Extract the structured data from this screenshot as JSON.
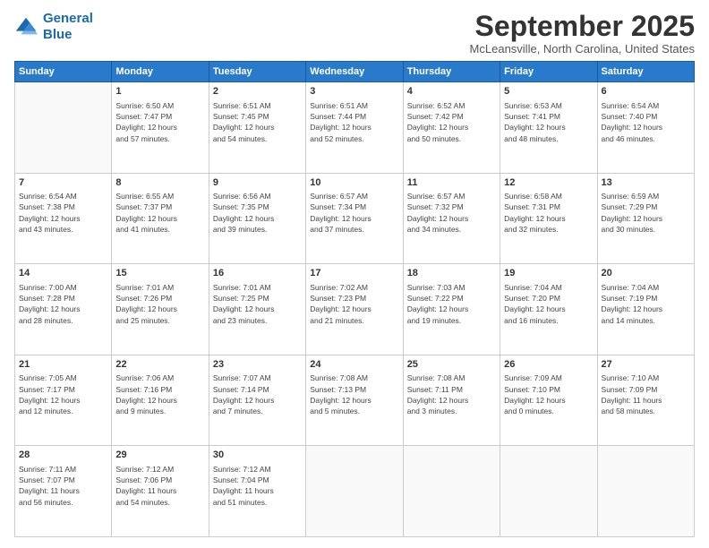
{
  "logo": {
    "line1": "General",
    "line2": "Blue"
  },
  "title": "September 2025",
  "location": "McLeansville, North Carolina, United States",
  "days_header": [
    "Sunday",
    "Monday",
    "Tuesday",
    "Wednesday",
    "Thursday",
    "Friday",
    "Saturday"
  ],
  "weeks": [
    [
      {
        "num": "",
        "info": ""
      },
      {
        "num": "1",
        "info": "Sunrise: 6:50 AM\nSunset: 7:47 PM\nDaylight: 12 hours\nand 57 minutes."
      },
      {
        "num": "2",
        "info": "Sunrise: 6:51 AM\nSunset: 7:45 PM\nDaylight: 12 hours\nand 54 minutes."
      },
      {
        "num": "3",
        "info": "Sunrise: 6:51 AM\nSunset: 7:44 PM\nDaylight: 12 hours\nand 52 minutes."
      },
      {
        "num": "4",
        "info": "Sunrise: 6:52 AM\nSunset: 7:42 PM\nDaylight: 12 hours\nand 50 minutes."
      },
      {
        "num": "5",
        "info": "Sunrise: 6:53 AM\nSunset: 7:41 PM\nDaylight: 12 hours\nand 48 minutes."
      },
      {
        "num": "6",
        "info": "Sunrise: 6:54 AM\nSunset: 7:40 PM\nDaylight: 12 hours\nand 46 minutes."
      }
    ],
    [
      {
        "num": "7",
        "info": "Sunrise: 6:54 AM\nSunset: 7:38 PM\nDaylight: 12 hours\nand 43 minutes."
      },
      {
        "num": "8",
        "info": "Sunrise: 6:55 AM\nSunset: 7:37 PM\nDaylight: 12 hours\nand 41 minutes."
      },
      {
        "num": "9",
        "info": "Sunrise: 6:56 AM\nSunset: 7:35 PM\nDaylight: 12 hours\nand 39 minutes."
      },
      {
        "num": "10",
        "info": "Sunrise: 6:57 AM\nSunset: 7:34 PM\nDaylight: 12 hours\nand 37 minutes."
      },
      {
        "num": "11",
        "info": "Sunrise: 6:57 AM\nSunset: 7:32 PM\nDaylight: 12 hours\nand 34 minutes."
      },
      {
        "num": "12",
        "info": "Sunrise: 6:58 AM\nSunset: 7:31 PM\nDaylight: 12 hours\nand 32 minutes."
      },
      {
        "num": "13",
        "info": "Sunrise: 6:59 AM\nSunset: 7:29 PM\nDaylight: 12 hours\nand 30 minutes."
      }
    ],
    [
      {
        "num": "14",
        "info": "Sunrise: 7:00 AM\nSunset: 7:28 PM\nDaylight: 12 hours\nand 28 minutes."
      },
      {
        "num": "15",
        "info": "Sunrise: 7:01 AM\nSunset: 7:26 PM\nDaylight: 12 hours\nand 25 minutes."
      },
      {
        "num": "16",
        "info": "Sunrise: 7:01 AM\nSunset: 7:25 PM\nDaylight: 12 hours\nand 23 minutes."
      },
      {
        "num": "17",
        "info": "Sunrise: 7:02 AM\nSunset: 7:23 PM\nDaylight: 12 hours\nand 21 minutes."
      },
      {
        "num": "18",
        "info": "Sunrise: 7:03 AM\nSunset: 7:22 PM\nDaylight: 12 hours\nand 19 minutes."
      },
      {
        "num": "19",
        "info": "Sunrise: 7:04 AM\nSunset: 7:20 PM\nDaylight: 12 hours\nand 16 minutes."
      },
      {
        "num": "20",
        "info": "Sunrise: 7:04 AM\nSunset: 7:19 PM\nDaylight: 12 hours\nand 14 minutes."
      }
    ],
    [
      {
        "num": "21",
        "info": "Sunrise: 7:05 AM\nSunset: 7:17 PM\nDaylight: 12 hours\nand 12 minutes."
      },
      {
        "num": "22",
        "info": "Sunrise: 7:06 AM\nSunset: 7:16 PM\nDaylight: 12 hours\nand 9 minutes."
      },
      {
        "num": "23",
        "info": "Sunrise: 7:07 AM\nSunset: 7:14 PM\nDaylight: 12 hours\nand 7 minutes."
      },
      {
        "num": "24",
        "info": "Sunrise: 7:08 AM\nSunset: 7:13 PM\nDaylight: 12 hours\nand 5 minutes."
      },
      {
        "num": "25",
        "info": "Sunrise: 7:08 AM\nSunset: 7:11 PM\nDaylight: 12 hours\nand 3 minutes."
      },
      {
        "num": "26",
        "info": "Sunrise: 7:09 AM\nSunset: 7:10 PM\nDaylight: 12 hours\nand 0 minutes."
      },
      {
        "num": "27",
        "info": "Sunrise: 7:10 AM\nSunset: 7:09 PM\nDaylight: 11 hours\nand 58 minutes."
      }
    ],
    [
      {
        "num": "28",
        "info": "Sunrise: 7:11 AM\nSunset: 7:07 PM\nDaylight: 11 hours\nand 56 minutes."
      },
      {
        "num": "29",
        "info": "Sunrise: 7:12 AM\nSunset: 7:06 PM\nDaylight: 11 hours\nand 54 minutes."
      },
      {
        "num": "30",
        "info": "Sunrise: 7:12 AM\nSunset: 7:04 PM\nDaylight: 11 hours\nand 51 minutes."
      },
      {
        "num": "",
        "info": ""
      },
      {
        "num": "",
        "info": ""
      },
      {
        "num": "",
        "info": ""
      },
      {
        "num": "",
        "info": ""
      }
    ]
  ]
}
